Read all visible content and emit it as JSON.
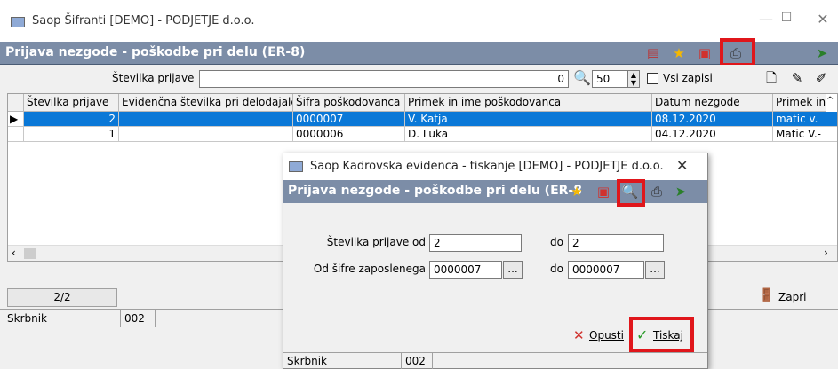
{
  "window": {
    "title": "Saop Šifranti [DEMO] - PODJETJE d.o.o.",
    "min_glyph": "—",
    "max_glyph": "☐",
    "close_glyph": "✕"
  },
  "header_bar": {
    "title": "Prijava nezgode - poškodbe pri delu (ER-8)"
  },
  "filter": {
    "label": "Številka prijave",
    "value": "",
    "count_value": "0",
    "page_size": "50",
    "all_records_label": "Vsi zapisi",
    "all_records_checked": false
  },
  "table": {
    "columns": [
      "Številka prijave",
      "Evidenčna številka pri delodajalcu",
      "Šifra poškodovanca",
      "Primek in ime poškodovanca",
      "Datum nezgode",
      "Primek in i"
    ],
    "rows": [
      {
        "number": "2",
        "evidence": "",
        "code": "0000007",
        "name": "V. Katja",
        "date": "08.12.2020",
        "extra": "matic v.",
        "selected": true
      },
      {
        "number": "1",
        "evidence": "",
        "code": "0000006",
        "name": "D. Luka",
        "date": "04.12.2020",
        "extra": "Matic V.-",
        "selected": false
      }
    ]
  },
  "status": {
    "record_counter": "2/2",
    "close_label": "Zapri",
    "owner_label": "Skrbnik",
    "owner_value": "002"
  },
  "dialog": {
    "title": "Saop Kadrovska evidenca  - tiskanje [DEMO] - PODJETJE d.o.o.",
    "header": "Prijava nezgode - poškodbe pri delu (ER-8)",
    "from_number_label": "Številka prijave od",
    "from_number_value": "2",
    "to_number_label": "do",
    "to_number_value": "2",
    "from_code_label": "Od šifre zaposlenega",
    "from_code_value": "0000007",
    "to_code_label": "do",
    "to_code_value": "0000007",
    "ellipsis": "...",
    "cancel_label": "Opusti",
    "print_label": "Tiskaj",
    "owner_label": "Skrbnik",
    "owner_value": "002"
  },
  "colors": {
    "accent_bar": "#7c8da7",
    "selection": "#0a78d7",
    "highlight": "#e0161b"
  }
}
